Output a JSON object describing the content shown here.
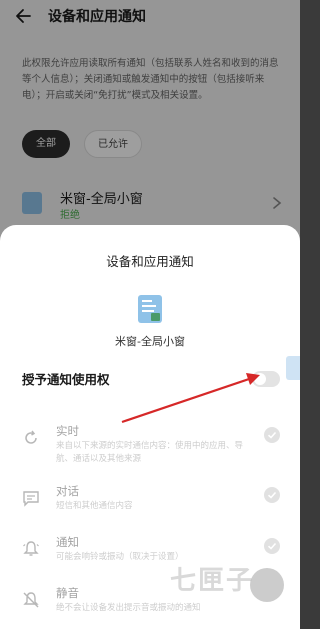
{
  "background_page": {
    "title": "设备和应用通知",
    "description": "此权限允许应用读取所有通知（包括联系人姓名和收到的消息等个人信息）；关闭通知或触发通知中的按钮（包括接听来电）；开启或关闭“免打扰”模式及相关设置。",
    "filters": [
      "全部",
      "已允许"
    ],
    "app_row": {
      "name": "米窗-全局小窗",
      "status": "拒绝"
    }
  },
  "sheet": {
    "title": "设备和应用通知",
    "app_name": "米窗-全局小窗",
    "grant_label": "授予通知使用权",
    "grant_enabled": false,
    "options": [
      {
        "icon": "sync-icon",
        "title": "实时",
        "desc": "来自以下来源的实时通信内容：使用中的应用、导航、通话以及其他来源"
      },
      {
        "icon": "message-icon",
        "title": "对话",
        "desc": "短信和其他通信内容"
      },
      {
        "icon": "bell-icon",
        "title": "通知",
        "desc": "可能会响铃或振动（取决于设置）"
      },
      {
        "icon": "silent-bell-icon",
        "title": "静音",
        "desc": "绝不会让设备发出提示音或振动的通知"
      }
    ]
  },
  "watermark": {
    "text": "七匣子"
  },
  "colors": {
    "status_denied": "#4caf50",
    "annotation_arrow": "#d62828",
    "chip_active_bg": "#2e2e2e"
  }
}
